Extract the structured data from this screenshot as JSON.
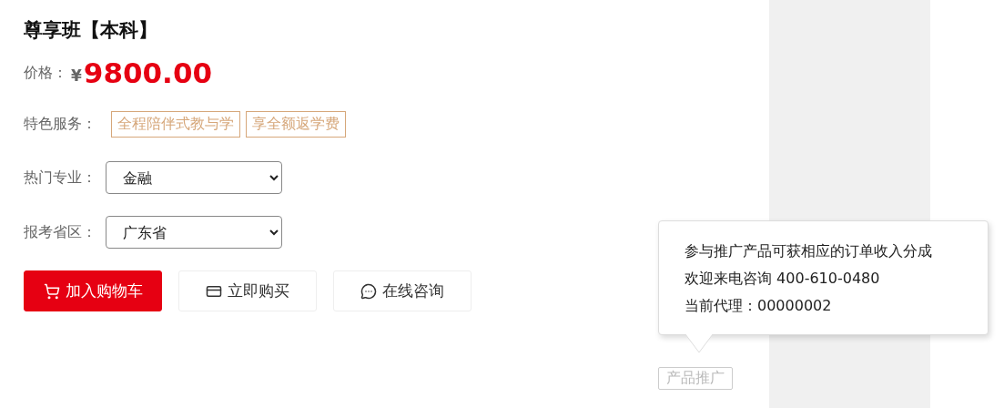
{
  "product": {
    "title": "尊享班【本科】"
  },
  "price": {
    "label": "价格：",
    "currency": "¥",
    "amount": "9800.00"
  },
  "services": {
    "label": "特色服务：",
    "tags": [
      "全程陪伴式教与学",
      "享全额返学费"
    ]
  },
  "selects": [
    {
      "label": "热门专业：",
      "value": "金融"
    },
    {
      "label": "报考省区：",
      "value": "广东省"
    }
  ],
  "buttons": [
    {
      "kind": "cart",
      "label": "加入购物车"
    },
    {
      "kind": "card",
      "label": "立即购买"
    },
    {
      "kind": "chat",
      "label": "在线咨询"
    }
  ],
  "promo": {
    "tooltip_lines": [
      "参与推广产品可获相应的订单收入分成",
      "欢迎来电咨询 400-610-0480",
      "当前代理：00000002"
    ],
    "badge": "产品推广"
  }
}
